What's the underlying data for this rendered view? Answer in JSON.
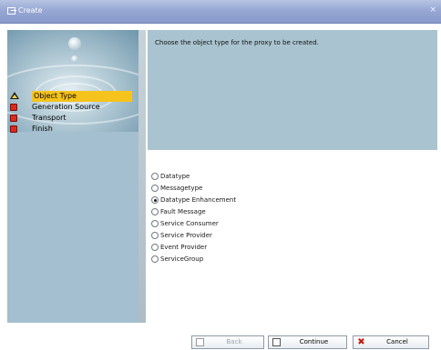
{
  "window": {
    "title": "Create",
    "close_glyph": "×"
  },
  "steps": [
    {
      "label": "Object Type",
      "status": "current"
    },
    {
      "label": "Generation Source",
      "status": "pending"
    },
    {
      "label": "Transport",
      "status": "pending"
    },
    {
      "label": "Finish",
      "status": "pending"
    }
  ],
  "description": "Choose the object type for the proxy to be created.",
  "options": [
    {
      "label": "Datatype",
      "checked": false
    },
    {
      "label": "Messagetype",
      "checked": false
    },
    {
      "label": "Datatype Enhancement",
      "checked": true
    },
    {
      "label": "Fault Message",
      "checked": false
    },
    {
      "label": "Service Consumer",
      "checked": false
    },
    {
      "label": "Service Provider",
      "checked": false
    },
    {
      "label": "Event Provider",
      "checked": false
    },
    {
      "label": "ServiceGroup",
      "checked": false
    }
  ],
  "buttons": {
    "back": {
      "label": "Back",
      "enabled": false
    },
    "continue": {
      "label": "Continue",
      "enabled": true
    },
    "cancel": {
      "label": "Cancel",
      "enabled": true
    }
  },
  "colors": {
    "title_bar": "#97a8d4",
    "panel_bg": "#a9c4d0",
    "active_step": "#f6c31c",
    "pending_marker": "#d92a1f"
  }
}
